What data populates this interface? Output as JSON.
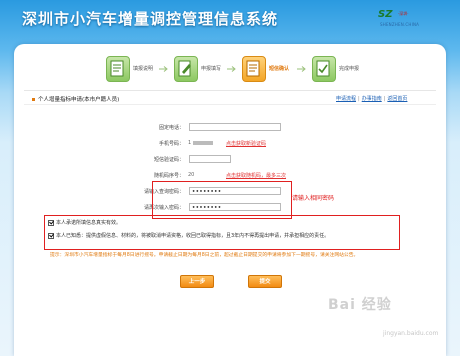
{
  "header": {
    "title": "深圳市小汽车增量调控管理信息系统",
    "logo_mark": "SZ",
    "logo_sub": "·深圳·",
    "logo_line": "SHENZHEN.CHINA"
  },
  "steps": [
    {
      "label": "填报说明",
      "state": "done"
    },
    {
      "label": "申报填写",
      "state": "done"
    },
    {
      "label": "短信确认",
      "state": "active"
    },
    {
      "label": "完成申报",
      "state": "pending"
    }
  ],
  "section": {
    "title": "个人增量指标申请(本市户籍人员)",
    "links": [
      "申请流程",
      "办事指南",
      "返回首页"
    ]
  },
  "form": {
    "fixed_phone": {
      "label": "固定电话："
    },
    "mobile": {
      "label": "手机号码：",
      "value_prefix": "1",
      "action": "点击获取新验证码"
    },
    "verify_code": {
      "label": "短信验证码："
    },
    "random_code": {
      "label": "随机码序号：",
      "value": "20",
      "hint": "点击获取随机码，最多三次"
    },
    "password": {
      "label": "请输入查询密码：",
      "value": "••••••••"
    },
    "password_confirm": {
      "label": "请再次输入密码：",
      "value": "••••••••"
    }
  },
  "annotation": "请输入相同密码",
  "checks": [
    {
      "text": "本人承诺所填信息真实有效。",
      "checked": true
    },
    {
      "text": "本人已知悉：提供虚假信息、材料的，将被取消申请资格，收回已取得指标，且3年内不得再提出申请，并承担相应的责任。",
      "checked": true
    }
  ],
  "note": "提示：深圳市小汽车增量指标于每月8日进行摇号。申请截止日期为每月8日之前，超过截止日期提交的申请将参加下一期摇号，请关注网站公告。",
  "buttons": {
    "prev": "上一步",
    "submit": "提交"
  },
  "watermark": "Bai 经验",
  "watermark_sub": "jingyan.baidu.com",
  "colors": {
    "accent": "#f28b12",
    "alert": "#e02020",
    "link": "#1a5fb4"
  }
}
